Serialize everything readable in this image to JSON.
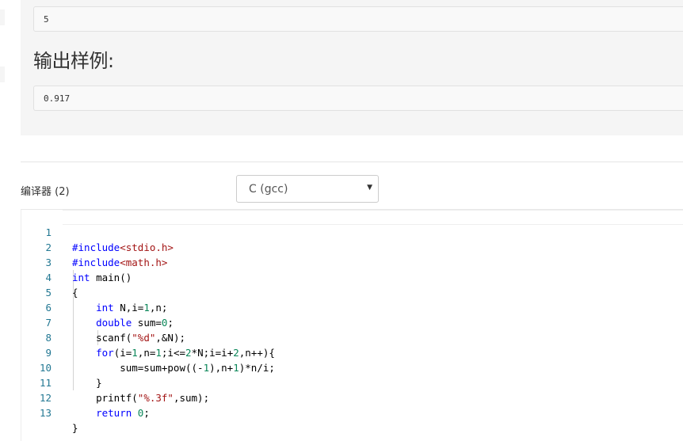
{
  "sample_input": {
    "value": "5"
  },
  "sample_output": {
    "title": "输出样例:",
    "value": "0.917"
  },
  "compiler": {
    "label": "编译器 (2)",
    "selected": "C (gcc)",
    "caret_icon": "triangle-down"
  },
  "editor": {
    "line_numbers": [
      "1",
      "2",
      "3",
      "4",
      "5",
      "6",
      "7",
      "8",
      "9",
      "10",
      "11",
      "12",
      "13"
    ],
    "lines": [
      "#include<stdio.h>",
      "#include<math.h>",
      "int main()",
      "{",
      "    int N,i=1,n;",
      "    double sum=0;",
      "    scanf(\"%d\",&N);",
      "    for(i=1,n=1;i<=2*N;i=i+2,n++){",
      "        sum=sum+pow((-1),n+1)*n/i;",
      "    }",
      "    printf(\"%.3f\",sum);",
      "    return 0;",
      "}"
    ]
  }
}
